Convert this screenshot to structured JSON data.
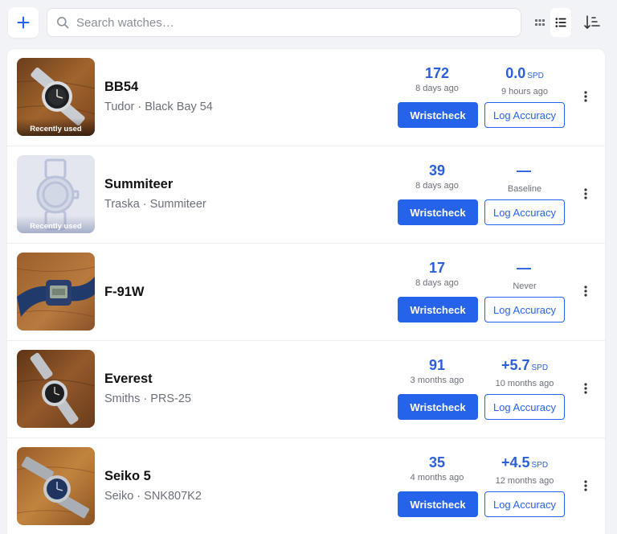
{
  "toolbar": {
    "add_icon": "plus-icon",
    "search_placeholder": "Search watches…",
    "search_value": "",
    "view_options": [
      "grid-view-icon",
      "list-view-icon"
    ],
    "active_view": "list",
    "sort_icon": "sort-descending-icon"
  },
  "watches": [
    {
      "name": "BB54",
      "subtitle": "Tudor · Black Bay 54",
      "checks": "172",
      "checks_sub": "8 days ago",
      "accuracy": "0.0",
      "accuracy_unit": "SPD",
      "accuracy_sub": "9 hours ago",
      "badge": "Recently used",
      "photo": "watch-photo-bb54",
      "primary_label": "Wristcheck",
      "secondary_label": "Log Accuracy"
    },
    {
      "name": "Summiteer",
      "subtitle": "Traska · Summiteer",
      "checks": "39",
      "checks_sub": "8 days ago",
      "accuracy": "—",
      "accuracy_unit": "",
      "accuracy_sub": "Baseline",
      "badge": "Recently used",
      "photo": "watch-placeholder",
      "primary_label": "Wristcheck",
      "secondary_label": "Log Accuracy"
    },
    {
      "name": "F-91W",
      "subtitle": "",
      "checks": "17",
      "checks_sub": "8 days ago",
      "accuracy": "—",
      "accuracy_unit": "",
      "accuracy_sub": "Never",
      "badge": "",
      "photo": "watch-photo-f91w",
      "primary_label": "Wristcheck",
      "secondary_label": "Log Accuracy"
    },
    {
      "name": "Everest",
      "subtitle": "Smiths · PRS-25",
      "checks": "91",
      "checks_sub": "3 months ago",
      "accuracy": "+5.7",
      "accuracy_unit": "SPD",
      "accuracy_sub": "10 months ago",
      "badge": "",
      "photo": "watch-photo-everest",
      "primary_label": "Wristcheck",
      "secondary_label": "Log Accuracy"
    },
    {
      "name": "Seiko 5",
      "subtitle": "Seiko · SNK807K2",
      "checks": "35",
      "checks_sub": "4 months ago",
      "accuracy": "+4.5",
      "accuracy_unit": "SPD",
      "accuracy_sub": "12 months ago",
      "badge": "",
      "photo": "watch-photo-seiko5",
      "primary_label": "Wristcheck",
      "secondary_label": "Log Accuracy"
    }
  ],
  "colors": {
    "accent": "#2563eb",
    "stat_value": "#2b5fd9",
    "muted_text": "#6b6f78",
    "background": "#f2f3f6"
  }
}
